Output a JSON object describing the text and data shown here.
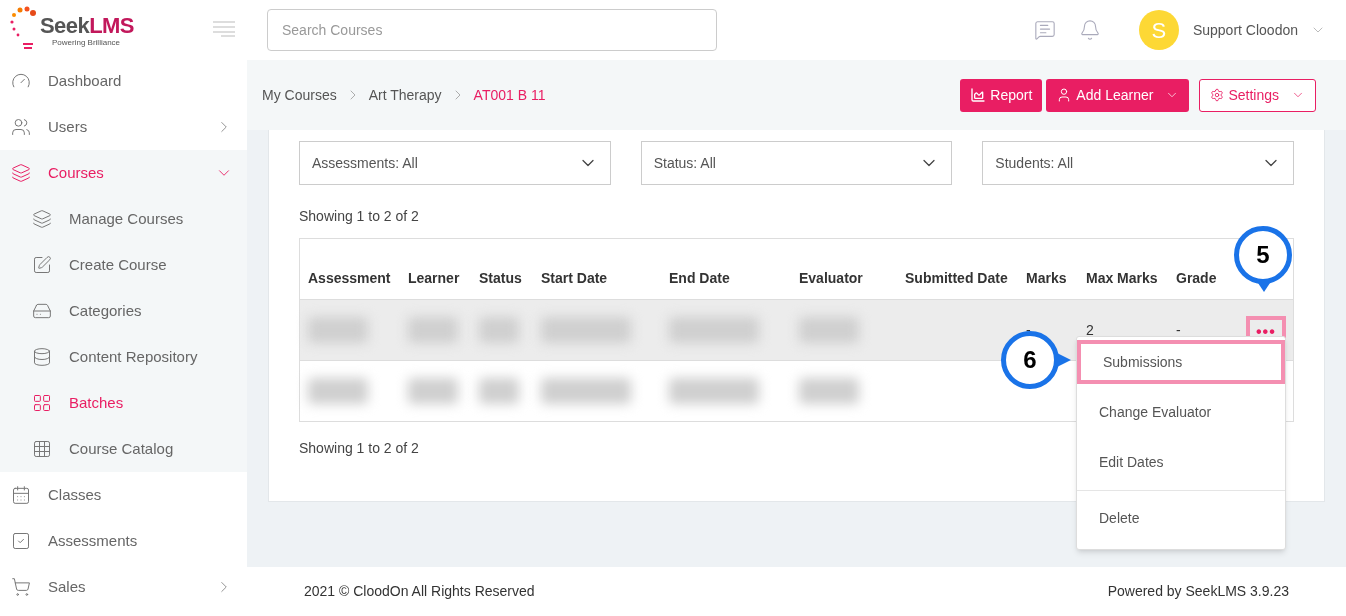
{
  "logo": {
    "name_dark": "Seek",
    "name_accent": "LMS",
    "tagline": "Powering Brilliance"
  },
  "sidebar": {
    "items": [
      {
        "kind": "dashboard",
        "label": "Dashboard",
        "selected": false,
        "has_arrow": false
      },
      {
        "kind": "users",
        "label": "Users",
        "selected": false,
        "has_arrow": true
      },
      {
        "kind": "courses",
        "label": "Courses",
        "selected": true,
        "has_arrow": true,
        "expanded": true,
        "children": [
          {
            "kind": "layers",
            "label": "Manage Courses",
            "selected": false
          },
          {
            "kind": "edit",
            "label": "Create Course",
            "selected": false
          },
          {
            "kind": "server",
            "label": "Categories",
            "selected": false
          },
          {
            "kind": "database",
            "label": "Content Repository",
            "selected": false
          },
          {
            "kind": "grid",
            "label": "Batches",
            "selected": true
          },
          {
            "kind": "grid9",
            "label": "Course Catalog",
            "selected": false
          }
        ]
      },
      {
        "kind": "calendar",
        "label": "Classes",
        "selected": false,
        "has_arrow": false
      },
      {
        "kind": "check",
        "label": "Assessments",
        "selected": false,
        "has_arrow": false
      },
      {
        "kind": "cart",
        "label": "Sales",
        "selected": false,
        "has_arrow": true
      }
    ]
  },
  "header": {
    "search": {
      "placeholder": "Search Courses"
    },
    "avatar_letter": "S",
    "user_name": "Support Cloodon"
  },
  "breadcrumb": [
    {
      "label": "My Courses",
      "current": false
    },
    {
      "label": "Art Therapy",
      "current": false
    },
    {
      "label": "AT001 B 11",
      "current": true
    }
  ],
  "actions": [
    {
      "kind": "report",
      "label": "Report"
    },
    {
      "kind": "add",
      "label": "Add Learner"
    },
    {
      "kind": "settings",
      "label": "Settings"
    }
  ],
  "filters": [
    {
      "value": "Assessments: All"
    },
    {
      "value": "Status: All"
    },
    {
      "value": "Students: All"
    }
  ],
  "showing_top": "Showing 1 to 2 of 2",
  "table": {
    "columns": [
      "Assessment",
      "Learner",
      "Status",
      "Start Date",
      "End Date",
      "Evaluator",
      "Submitted Date",
      "Marks",
      "Max Marks",
      "Grade"
    ],
    "rows": [
      {
        "selected": true,
        "marks": "-",
        "max_marks": "2",
        "grade": "-",
        "menu_button": {
          "label": "•••",
          "highlighted": true
        }
      },
      {
        "selected": false
      }
    ]
  },
  "showing_bottom": "Showing 1 to 2 of 2",
  "row_menu": {
    "items": [
      {
        "label": "Submissions",
        "highlighted": true,
        "divider_before": false
      },
      {
        "label": "Change Evaluator",
        "highlighted": false,
        "divider_before": false
      },
      {
        "label": "Edit Dates",
        "highlighted": false,
        "divider_before": false
      },
      {
        "label": "Delete",
        "highlighted": false,
        "divider_before": true
      }
    ]
  },
  "callouts": [
    {
      "label": "5"
    },
    {
      "label": "6"
    }
  ],
  "footer": {
    "copyright": "2021 © CloodOn All Rights Reserved",
    "powered": "Powered by SeekLMS 3.9.23"
  }
}
